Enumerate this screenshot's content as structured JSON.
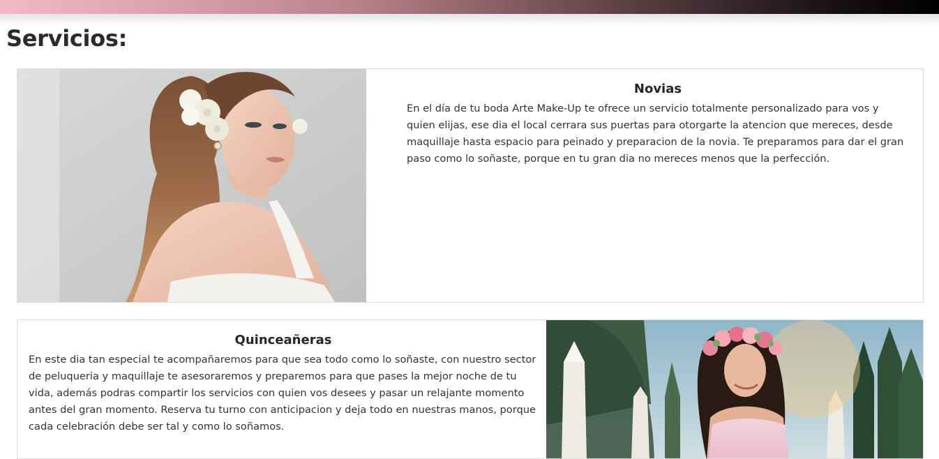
{
  "page": {
    "title": "Servicios:"
  },
  "services": [
    {
      "title": "Novias",
      "text": "En el día de tu boda Arte Make-Up te ofrece un servicio totalmente personalizado para vos y quien elijas, ese dia el local cerrara sus puertas para otorgarte la atencion que mereces, desde maquillaje hasta espacio para peinado y preparacion de la novia. Te preparamos para dar el gran paso como lo soñaste, porque en tu gran dia no mereces menos que la perfección."
    },
    {
      "title": "Quinceañeras",
      "text": "En este dia tan especial te acompañaremos para que sea todo como lo soñaste, con nuestro sector de peluqueria y maquillaje te asesoraremos y preparemos para que pases la mejor noche de tu vida, además podras compartir los servicios con quien vos desees y pasar un relajante momento antes del gran momento. Reserva tu turno con anticipacion y deja todo en nuestras manos, porque cada celebración debe ser tal y como lo soñamos."
    }
  ],
  "colors": {
    "topbar_start": "#f3b9c9",
    "topbar_end": "#000000",
    "card_border": "#dcdcdc"
  }
}
